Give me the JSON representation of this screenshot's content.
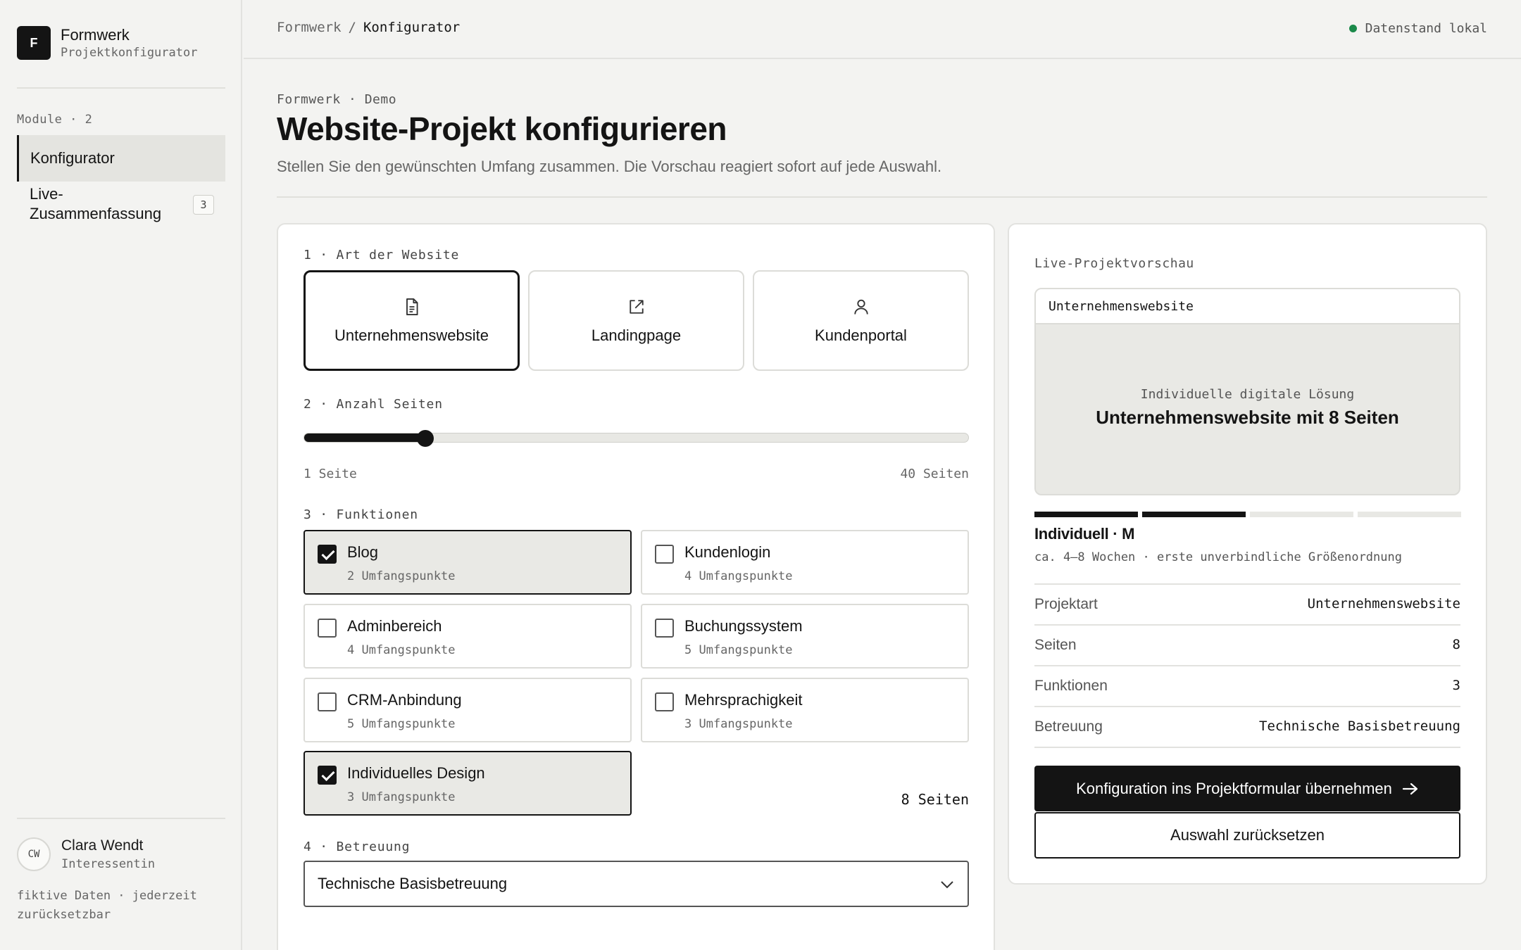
{
  "sidebar": {
    "brand_mark": "F",
    "brand_title": "Formwerk",
    "brand_subtitle": "Projektkonfigurator",
    "module_heading": "Module · 2",
    "items": [
      {
        "label": "Konfigurator",
        "active": true
      },
      {
        "label": "Live-Zusammenfassung",
        "badge": "3",
        "active": false
      }
    ],
    "user": {
      "initials": "CW",
      "name": "Clara Wendt",
      "role": "Interessentin"
    },
    "footnote": "fiktive Daten · jederzeit zurücksetzbar"
  },
  "topbar": {
    "crumb_root": "Formwerk",
    "crumb_sep": "/",
    "crumb_current": "Konfigurator",
    "status": "Datenstand lokal",
    "status_color": "#1b8a4a"
  },
  "header": {
    "eyebrow": "Formwerk · Demo",
    "title": "Website-Projekt konfigurieren",
    "subtitle": "Stellen Sie den gewünschten Umfang zusammen. Die Vorschau reagiert sofort auf jede Auswahl."
  },
  "config": {
    "section1_label": "1 · Art der Website",
    "types": [
      {
        "label": "Unternehmenswebsite",
        "icon": "document-icon",
        "selected": true
      },
      {
        "label": "Landingpage",
        "icon": "external-link-icon",
        "selected": false
      },
      {
        "label": "Kundenportal",
        "icon": "user-icon",
        "selected": false
      }
    ],
    "section2_label": "2 · Anzahl Seiten",
    "pages_value": "8 Seiten",
    "slider": {
      "min": 1,
      "max": 40,
      "value": 8,
      "min_label": "1 Seite",
      "max_label": "40 Seiten"
    },
    "section3_label": "3 · Funktionen",
    "features": [
      {
        "name": "Blog",
        "points": "2 Umfangspunkte",
        "checked": true
      },
      {
        "name": "Kundenlogin",
        "points": "4 Umfangspunkte",
        "checked": false
      },
      {
        "name": "Adminbereich",
        "points": "4 Umfangspunkte",
        "checked": false
      },
      {
        "name": "Buchungssystem",
        "points": "5 Umfangspunkte",
        "checked": false
      },
      {
        "name": "CRM-Anbindung",
        "points": "5 Umfangspunkte",
        "checked": false
      },
      {
        "name": "Mehrsprachigkeit",
        "points": "3 Umfangspunkte",
        "checked": false
      },
      {
        "name": "Individuelles Design",
        "points": "3 Umfangspunkte",
        "checked": true
      }
    ],
    "section4_label": "4 · Betreuung",
    "support_selected": "Technische Basisbetreuung"
  },
  "preview": {
    "label": "Live-Projektvorschau",
    "window_title": "Unternehmenswebsite",
    "kicker": "Individuelle digitale Lösung",
    "headline": "Unternehmenswebsite mit 8 Seiten",
    "level_filled": 2,
    "level_total": 4,
    "tier": "Individuell · M",
    "tier_sub": "ca. 4–8 Wochen · erste unverbindliche Größenordnung",
    "summary": [
      {
        "key": "Projektart",
        "value": "Unternehmenswebsite"
      },
      {
        "key": "Seiten",
        "value": "8"
      },
      {
        "key": "Funktionen",
        "value": "3"
      },
      {
        "key": "Betreuung",
        "value": "Technische Basisbetreuung"
      }
    ],
    "primary_button": "Konfiguration ins Projektformular übernehmen",
    "secondary_button": "Auswahl zurücksetzen"
  }
}
